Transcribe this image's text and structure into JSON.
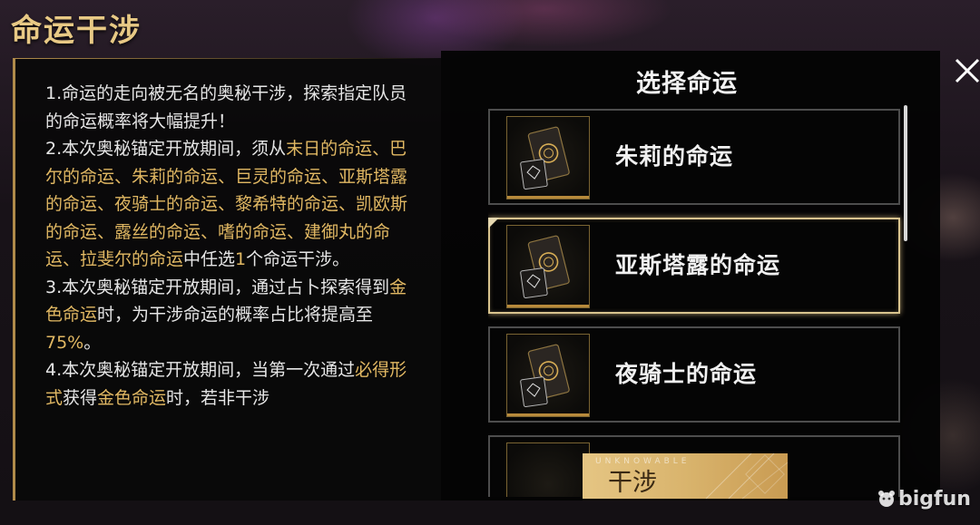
{
  "title": "命运干涉",
  "close_icon": "close-icon",
  "rules": {
    "p1": "1.命运的走向被无名的奥秘干涉，探索指定队员的命运概率将大幅提升！",
    "p2": [
      {
        "t": "2.本次奥秘锚定开放期间，须从",
        "gold": false
      },
      {
        "t": "末日的命运、巴尔的命运、朱莉的命运、巨灵的命运、亚斯塔露的命运、夜骑士的命运、黎希特的命运、凯欧斯的命运、露丝的命运、嗜的命运、建御丸的命运、拉斐尔的命运",
        "gold": true
      },
      {
        "t": "中任选",
        "gold": false
      },
      {
        "t": "1",
        "gold": true
      },
      {
        "t": "个命运干涉。",
        "gold": false
      }
    ],
    "p3": [
      {
        "t": "3.本次奥秘锚定开放期间，通过占卜探索得到",
        "gold": false
      },
      {
        "t": "金色命运",
        "gold": true
      },
      {
        "t": "时，为干涉命运的概率占比将提高至",
        "gold": false
      },
      {
        "t": "75%",
        "gold": true
      },
      {
        "t": "。",
        "gold": false
      }
    ],
    "p4": [
      {
        "t": "4.本次奥秘锚定开放期间，当第一次通过",
        "gold": false
      },
      {
        "t": "必得形式",
        "gold": true
      },
      {
        "t": "获得",
        "gold": false
      },
      {
        "t": "金色命运",
        "gold": true
      },
      {
        "t": "时，若非干涉",
        "gold": false
      }
    ]
  },
  "select_panel": {
    "title": "选择命运",
    "items": [
      {
        "name": "朱莉的命运",
        "selected": false
      },
      {
        "name": "亚斯塔露的命运",
        "selected": true
      },
      {
        "name": "夜骑士的命运",
        "selected": false
      },
      {
        "name": "",
        "selected": false
      }
    ]
  },
  "interfere_button": {
    "sub": "UNKNOWABLE",
    "label": "干涉"
  },
  "watermark": "bigfun",
  "colors": {
    "gold_text": "#e1b863",
    "title_gold": "#e8c985",
    "button_gold": "#d9b46d",
    "selected_border": "#d9c48e"
  }
}
